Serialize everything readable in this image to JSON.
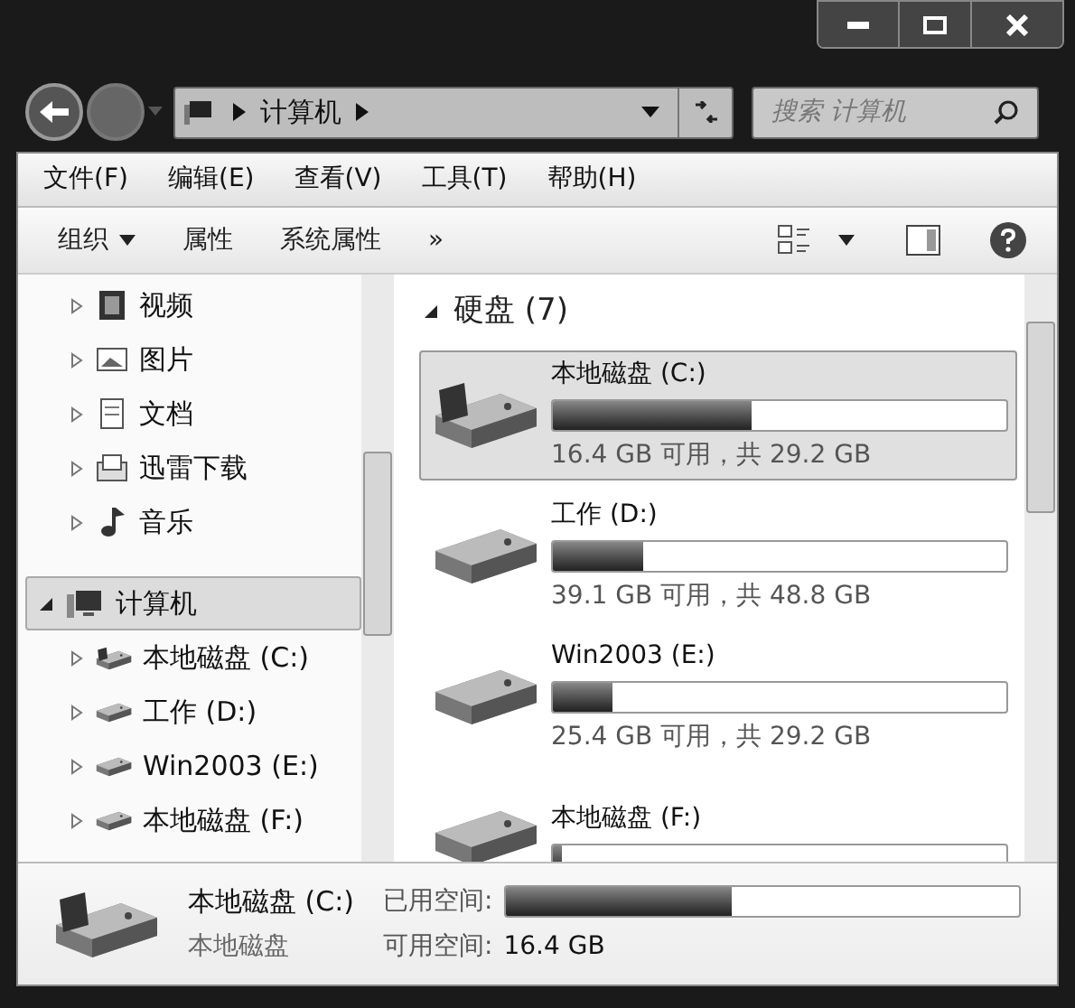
{
  "address": {
    "crumbs": [
      "计算机"
    ]
  },
  "search": {
    "placeholder": "搜索 计算机"
  },
  "menu": [
    "文件(F)",
    "编辑(E)",
    "查看(V)",
    "工具(T)",
    "帮助(H)"
  ],
  "toolbar": [
    {
      "label": "组织",
      "dropdown": true
    },
    {
      "label": "属性",
      "dropdown": false
    },
    {
      "label": "系统属性",
      "dropdown": false
    },
    {
      "label": "»",
      "dropdown": false
    }
  ],
  "nav": [
    {
      "label": "视频",
      "expanded": false,
      "selected": false
    },
    {
      "label": "图片",
      "expanded": false,
      "selected": false
    },
    {
      "label": "文档",
      "expanded": false,
      "selected": false
    },
    {
      "label": "迅雷下载",
      "expanded": false,
      "selected": false
    },
    {
      "label": "音乐",
      "expanded": false,
      "selected": false
    },
    {
      "label": "计算机",
      "expanded": true,
      "selected": true,
      "children": [
        {
          "label": "本地磁盘 (C:)",
          "expanded": false,
          "selected": false
        },
        {
          "label": "工作 (D:)",
          "expanded": false,
          "selected": false
        },
        {
          "label": "Win2003 (E:)",
          "expanded": false,
          "selected": false
        },
        {
          "label": "本地磁盘 (F:)",
          "expanded": false,
          "selected": false
        }
      ]
    }
  ],
  "group": {
    "title": "硬盘 (7)",
    "expanded": true
  },
  "drives": [
    {
      "name": "本地磁盘 (C:)",
      "level": 0.44,
      "reading": "16.4 GB 可用，共 29.2 GB",
      "selected": true
    },
    {
      "name": "工作 (D:)",
      "level": 0.2,
      "reading": "39.1 GB 可用，共 48.8 GB",
      "selected": false
    },
    {
      "name": "Win2003 (E:)",
      "level": 0.13,
      "reading": "25.4 GB 可用，共 29.2 GB",
      "selected": false
    },
    {
      "name": "本地磁盘 (F:)",
      "level": 0.02,
      "selected": false
    }
  ],
  "details": {
    "name": "本地磁盘 (C:)",
    "type": "本地磁盘",
    "used_label": "已用空间:",
    "level": 0.44,
    "free_label": "可用空间:",
    "free": "16.4 GB"
  }
}
